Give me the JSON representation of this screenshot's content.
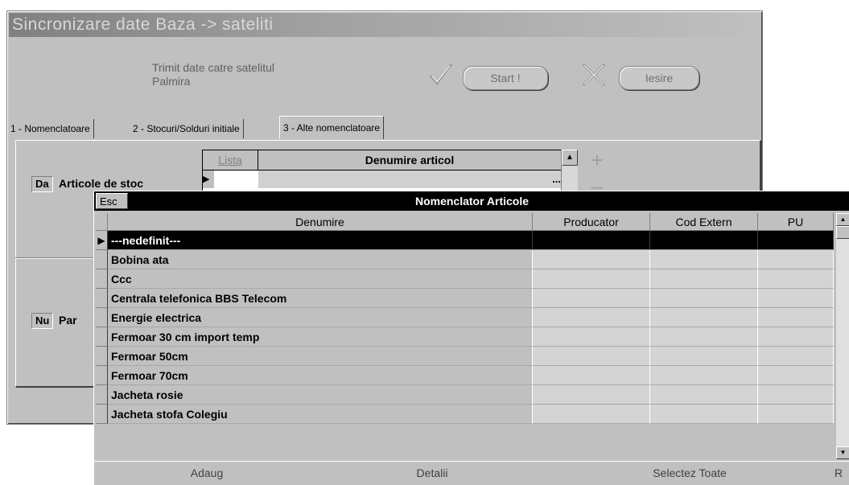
{
  "window": {
    "title": "Sincronizare date Baza -> sateliti",
    "info_line1": "Trimit date catre satelitul",
    "info_line2": "Palmira",
    "start_label": "Start !",
    "exit_label": "Iesire"
  },
  "tabs": [
    {
      "label": "1 - Nomenclatoare"
    },
    {
      "label": "2 - Stocuri/Solduri initiale"
    },
    {
      "label": "3 - Alte nomenclatoare"
    }
  ],
  "panel": {
    "row1": {
      "flag": "Da",
      "label": "Articole de stoc"
    },
    "row2": {
      "flag": "Nu",
      "label": "Par"
    },
    "mini_grid": {
      "col1": "Lista",
      "col2": "Denumire articol",
      "row_value": "..."
    }
  },
  "popup": {
    "esc_label": "Esc",
    "title": "Nomenclator Articole",
    "columns": {
      "denumire": "Denumire",
      "producator": "Producator",
      "cod_extern": "Cod Extern",
      "pu": "PU"
    },
    "rows": [
      {
        "denumire": "---nedefinit---"
      },
      {
        "denumire": "Bobina ata"
      },
      {
        "denumire": "Ccc"
      },
      {
        "denumire": "Centrala telefonica BBS Telecom"
      },
      {
        "denumire": "Energie electrica"
      },
      {
        "denumire": "Fermoar 30 cm import temp"
      },
      {
        "denumire": "Fermoar 50cm"
      },
      {
        "denumire": "Fermoar 70cm"
      },
      {
        "denumire": "Jacheta rosie"
      },
      {
        "denumire": "Jacheta stofa Colegiu"
      }
    ],
    "footer": {
      "add": "Adaug",
      "details": "Detalii",
      "select_all": "Selectez Toate",
      "last": "R"
    }
  }
}
